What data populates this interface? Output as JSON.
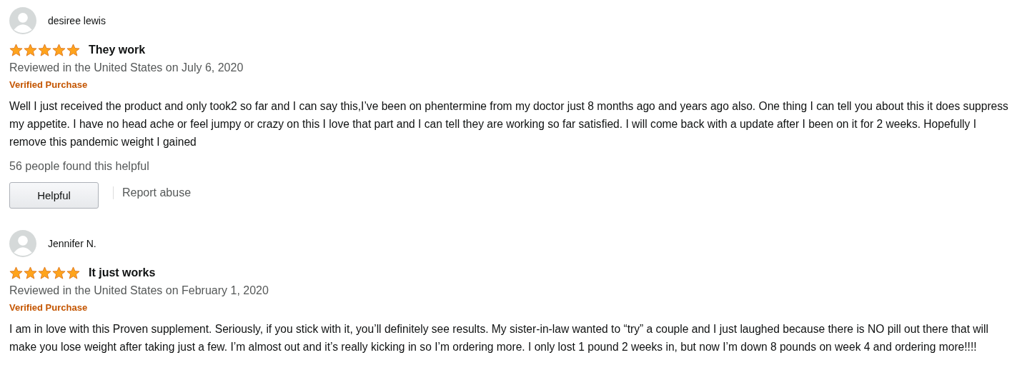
{
  "reviews": [
    {
      "author": "desiree lewis",
      "stars": 5,
      "title": "They work",
      "date": "Reviewed in the United States on July 6, 2020",
      "badge": "Verified Purchase",
      "body": "Well I just received the product and only took2 so far and I can say this,I’ve been on phentermine from my doctor just 8 months ago and years ago also. One thing I can tell you about this it does suppress my appetite. I have no head ache or feel jumpy or crazy on this I love that part and I can tell they are working so far satisfied. I will come back with a update after I been on it for 2 weeks. Hopefully I remove this pandemic weight I gained",
      "helpful_count": "56 people found this helpful",
      "helpful_button": "Helpful",
      "report_link": "Report abuse"
    },
    {
      "author": "Jennifer N.",
      "stars": 5,
      "title": "It just works",
      "date": "Reviewed in the United States on February 1, 2020",
      "badge": "Verified Purchase",
      "body": "I am in love with this Proven supplement. Seriously, if you stick with it, you’ll definitely see results. My sister-in-law wanted to “try” a couple and I just laughed because there is NO pill out there that will make you lose weight after taking just a few. I’m almost out and it’s really kicking in so I’m ordering more. I only lost 1 pound 2 weeks in, but now I’m down 8 pounds on week 4 and ordering more!!!!"
    }
  ]
}
